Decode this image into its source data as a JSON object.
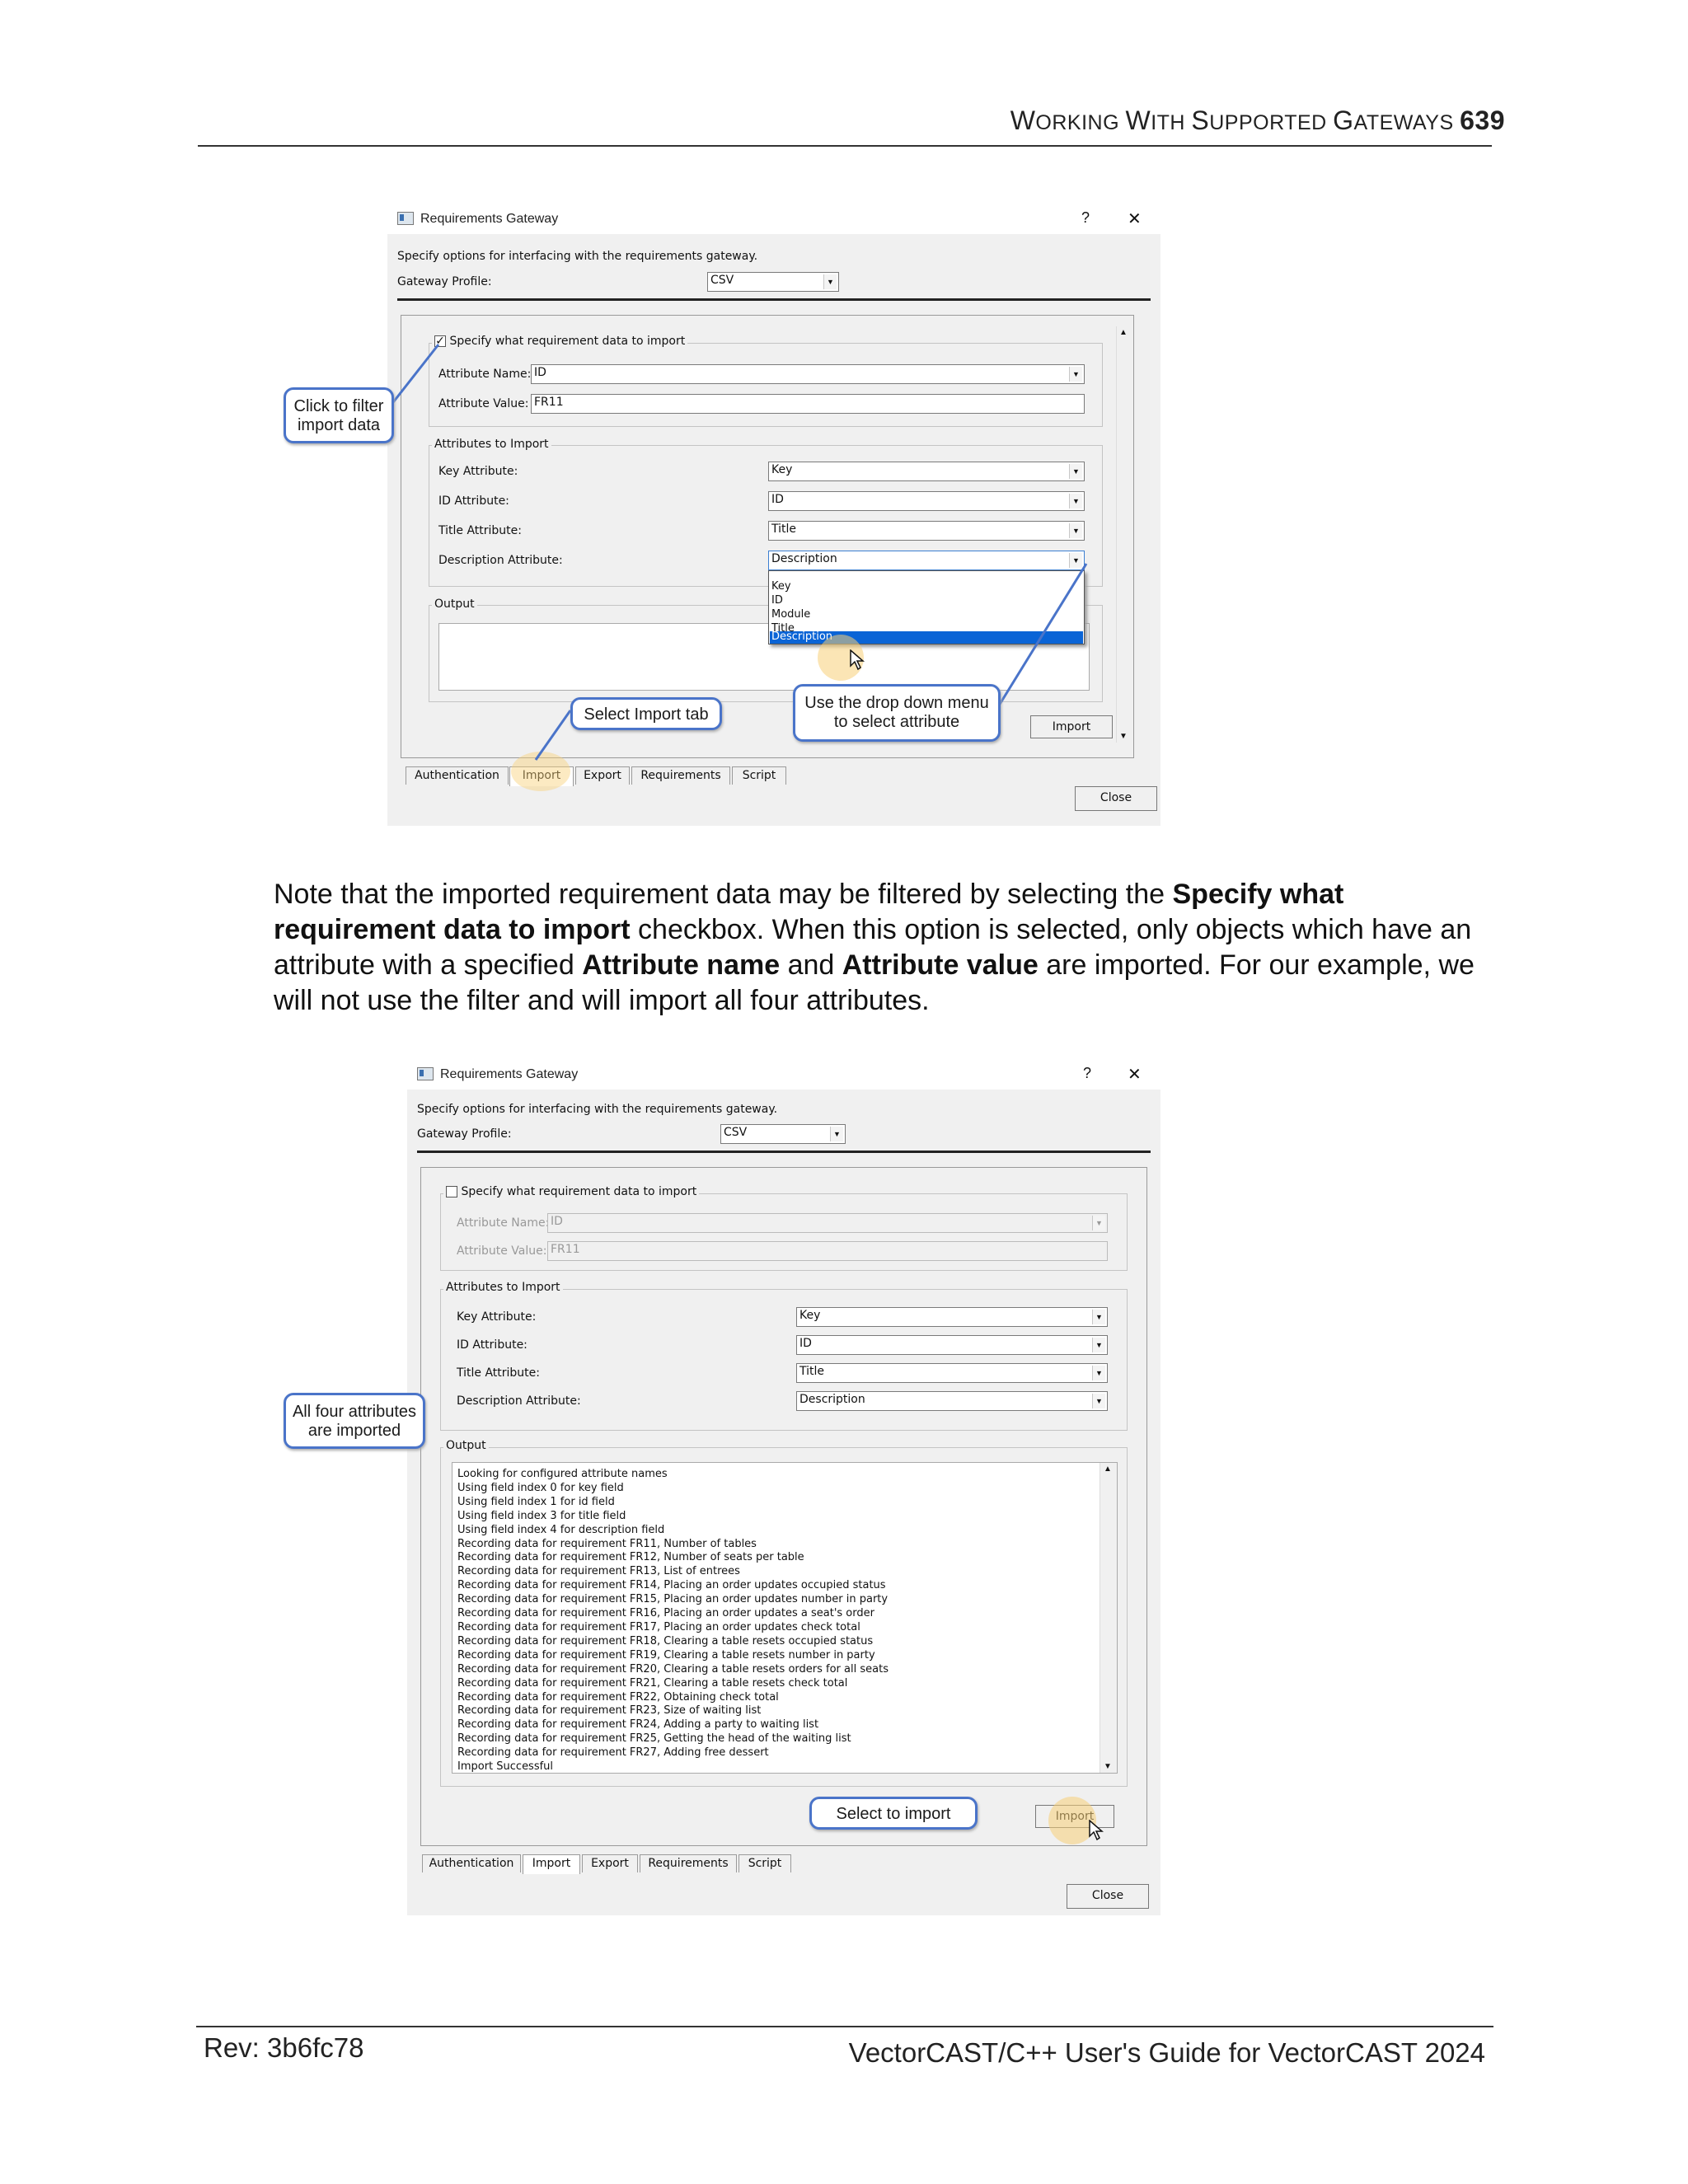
{
  "page": {
    "header_parts": {
      "w1": "W",
      "s1": "ORKING ",
      "w2": "W",
      "s2": "ITH ",
      "w3": "S",
      "s3": "UPPORTED ",
      "w4": "G",
      "s4": "ATEWAYS "
    },
    "page_number": "639",
    "body": {
      "t1": "Note that the imported requirement data may be filtered by selecting the ",
      "b1": "Specify what requirement data to import",
      "t2": " checkbox. When this option is selected, only objects which have an attribute with a specified ",
      "b2": "Attribute name",
      "t3": " and ",
      "b3": "Attribute value",
      "t4": " are imported. For our example, we will not use the filter and will import all four attributes."
    },
    "footer_left": "Rev: 3b6fc78",
    "footer_right": "VectorCAST/C++ User's Guide for VectorCAST 2024"
  },
  "dialog1": {
    "title": "Requirements Gateway",
    "help": "?",
    "close_x": "✕",
    "description": "Specify options for interfacing with the requirements gateway.",
    "profile_label": "Gateway Profile:",
    "profile_value": "CSV",
    "filter_checkbox_label": "Specify what requirement data to import",
    "filter_checked": true,
    "attr_name_label": "Attribute Name:",
    "attr_name_value": "ID",
    "attr_value_label": "Attribute Value:",
    "attr_value_value": "FR11",
    "attrs_group": "Attributes to Import",
    "key_label": "Key Attribute:",
    "key_value": "Key",
    "id_label": "ID Attribute:",
    "id_value": "ID",
    "title_label": "Title Attribute:",
    "title_value": "Title",
    "desc_label": "Description Attribute:",
    "desc_value": "Description",
    "dropdown_options": [
      "Key",
      "ID",
      "Module",
      "Title",
      "Description"
    ],
    "dropdown_selected": "Description",
    "output_group": "Output",
    "import_button": "Import",
    "tabs": [
      "Authentication",
      "Import",
      "Export",
      "Requirements",
      "Script"
    ],
    "active_tab": "Import",
    "close_button": "Close",
    "callouts": {
      "filter_a": "Click to filter",
      "filter_b": "import data",
      "tab": "Select Import tab",
      "drop_a": "Use the drop down menu",
      "drop_b": "to select attribute"
    }
  },
  "dialog2": {
    "title": "Requirements Gateway",
    "help": "?",
    "close_x": "✕",
    "description": "Specify options for interfacing with the requirements gateway.",
    "profile_label": "Gateway Profile:",
    "profile_value": "CSV",
    "filter_checkbox_label": "Specify what requirement data to import",
    "filter_checked": false,
    "attr_name_label": "Attribute Name:",
    "attr_name_value": "ID",
    "attr_value_label": "Attribute Value:",
    "attr_value_value": "FR11",
    "attrs_group": "Attributes to Import",
    "key_label": "Key Attribute:",
    "key_value": "Key",
    "id_label": "ID Attribute:",
    "id_value": "ID",
    "title_label": "Title Attribute:",
    "title_value": "Title",
    "desc_label": "Description Attribute:",
    "desc_value": "Description",
    "output_group": "Output",
    "output_lines": [
      "Looking for configured attribute names",
      "Using field index 0 for key field",
      "Using field index 1 for id field",
      "Using field index 3 for title field",
      "Using field index 4 for description field",
      "Recording data for requirement FR11, Number of tables",
      "Recording data for requirement FR12, Number of seats per table",
      "Recording data for requirement FR13, List of entrees",
      "Recording data for requirement FR14, Placing an order updates occupied status",
      "Recording data for requirement FR15, Placing an order updates number in party",
      "Recording data for requirement FR16, Placing an order updates a seat's order",
      "Recording data for requirement FR17, Placing an order updates check total",
      "Recording data for requirement FR18, Clearing a table resets occupied status",
      "Recording data for requirement FR19, Clearing a table resets number in party",
      "Recording data for requirement FR20, Clearing a table resets orders for all seats",
      "Recording data for requirement FR21, Clearing a table resets check total",
      "Recording data for requirement FR22, Obtaining check total",
      "Recording data for requirement FR23, Size of waiting list",
      "Recording data for requirement FR24, Adding a party to waiting list",
      "Recording data for requirement FR25, Getting the head of the waiting list",
      "Recording data for requirement FR27, Adding free dessert",
      "Import Successful"
    ],
    "import_button": "Import",
    "tabs": [
      "Authentication",
      "Import",
      "Export",
      "Requirements",
      "Script"
    ],
    "active_tab": "Import",
    "close_button": "Close",
    "callouts": {
      "attrs_a": "All four attributes",
      "attrs_b": "are imported",
      "import": "Select to import"
    }
  }
}
